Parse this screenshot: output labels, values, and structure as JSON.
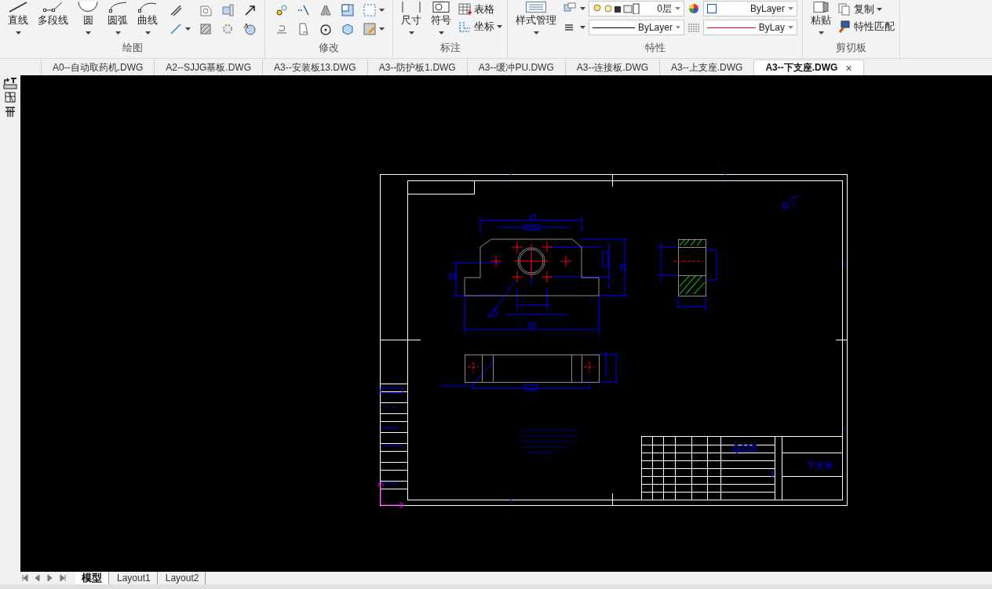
{
  "ribbon": [
    {
      "kind": "draw",
      "title": "绘图",
      "buttons": [
        {
          "label": "直线",
          "dropdown": true
        },
        {
          "label": "多段线",
          "dropdown": false
        },
        {
          "label": "圆",
          "dropdown": true
        },
        {
          "label": "圆弧",
          "dropdown": true
        },
        {
          "label": "曲线",
          "dropdown": true
        }
      ],
      "icons": [
        {
          "dropdown": false
        },
        {
          "dropdown": false
        },
        {
          "dropdown": false
        },
        {
          "dropdown": false
        },
        {
          "dropdown": true
        },
        {
          "dropdown": false
        },
        {
          "dropdown": false
        },
        {
          "dropdown": false
        }
      ]
    },
    {
      "kind": "modify",
      "title": "修改",
      "icons": [
        {
          "dropdown": false
        },
        {
          "dropdown": false
        },
        {
          "dropdown": false
        },
        {
          "dropdown": false
        },
        {
          "dropdown": true
        },
        {
          "dropdown": false
        },
        {
          "dropdown": false
        },
        {
          "dropdown": false
        },
        {
          "dropdown": false
        },
        {
          "dropdown": true
        }
      ]
    },
    {
      "kind": "annotate",
      "title": "标注",
      "buttons": [
        {
          "label": "尺寸",
          "dropdown": true
        },
        {
          "label": "符号",
          "dropdown": true
        }
      ],
      "small": [
        {
          "label": "表格",
          "dropdown": false
        },
        {
          "label": "坐标",
          "dropdown": true
        }
      ]
    },
    {
      "kind": "properties",
      "title": "特性",
      "buttons": [
        {
          "label": "样式管理",
          "dropdown": true
        }
      ],
      "combos": [
        {
          "kind": "layer",
          "value": "0层"
        },
        {
          "kind": "color",
          "value": "ByLayer",
          "color": "#0050ff"
        },
        {
          "kind": "line",
          "value": "ByLayer",
          "color": "#000000"
        },
        {
          "kind": "line",
          "value": "ByLay",
          "color": "#ff0000"
        }
      ]
    },
    {
      "kind": "clipboard",
      "title": "剪切板",
      "buttons": [
        {
          "label": "粘贴",
          "dropdown": true
        }
      ],
      "small": [
        {
          "label": "复制",
          "dropdown": true
        },
        {
          "label": "特性匹配",
          "dropdown": false
        }
      ]
    }
  ],
  "document_tabs": [
    {
      "label": "A0--自动取药机.DWG",
      "selected": false
    },
    {
      "label": "A2--SJJG基板.DWG",
      "selected": false
    },
    {
      "label": "A3--安装板13.DWG",
      "selected": false
    },
    {
      "label": "A3--防护板1.DWG",
      "selected": false
    },
    {
      "label": "A3--缓冲PU.DWG",
      "selected": false
    },
    {
      "label": "A3--连接板.DWG",
      "selected": false
    },
    {
      "label": "A3--上支座.DWG",
      "selected": false
    },
    {
      "label": "A3--下支座.DWG",
      "selected": true,
      "close": "×"
    }
  ],
  "drawing": {
    "material": "Q235",
    "part_name": "下支座"
  },
  "layout_tabs": [
    {
      "label": "模型",
      "selected": true
    },
    {
      "label": "Layout1",
      "selected": false
    },
    {
      "label": "Layout2",
      "selected": false
    }
  ]
}
